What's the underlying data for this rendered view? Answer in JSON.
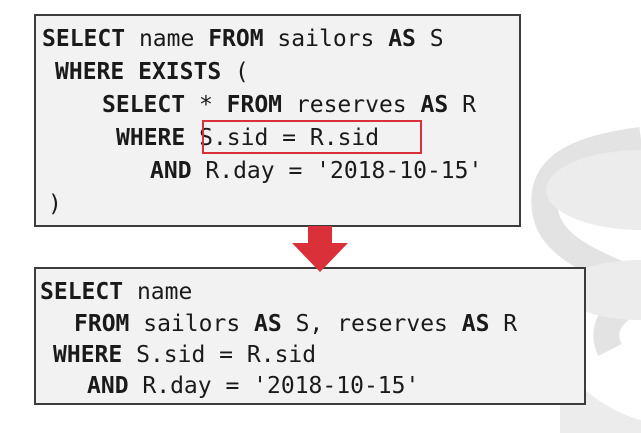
{
  "top_query": {
    "line1": {
      "kw1": "SELECT",
      "t1": " name ",
      "kw2": "FROM",
      "t2": " sailors ",
      "kw3": "AS",
      "t3": " S"
    },
    "line2": {
      "kw1": "WHERE",
      "t1": " ",
      "kw2": "EXISTS",
      "t2": " ("
    },
    "line3": {
      "kw1": "SELECT",
      "t1": " * ",
      "kw2": "FROM",
      "t2": " reserves ",
      "kw3": "AS",
      "t3": " R"
    },
    "line4": {
      "kw1": "WHERE",
      "t1": " S.sid = R.sid"
    },
    "line5": {
      "kw1": "AND",
      "t1": " R.day = '2018-10-15'"
    },
    "line6": {
      "t1": ")"
    }
  },
  "bottom_query": {
    "line1": {
      "kw1": "SELECT",
      "t1": " name"
    },
    "line2": {
      "kw1": "FROM",
      "t1": " sailors ",
      "kw2": "AS",
      "t2": " S, reserves ",
      "kw3": "AS",
      "t3": " R"
    },
    "line3": {
      "kw1": "WHERE",
      "t1": " S.sid = R.sid"
    },
    "line4": {
      "kw1": "AND",
      "t1": " R.day = '2018-10-15'"
    }
  },
  "colors": {
    "accent": "#d9303a",
    "box_border": "#3c3c3c",
    "box_fill": "#f2f2f2",
    "text": "#1a1a1a"
  }
}
